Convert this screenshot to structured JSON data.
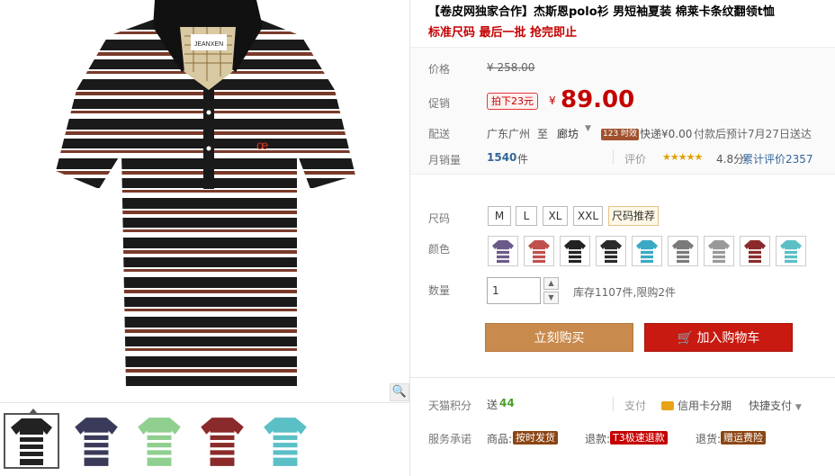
{
  "product": {
    "title": "【卷皮网独家合作】杰斯恩polo衫 男短袖夏装 棉莱卡条纹翻领t恤",
    "subtitle": "标准尺码 最后一批 抢完即止",
    "brand_label": "JEANXEN"
  },
  "price": {
    "label": "价格",
    "original": "¥ 258.00",
    "promo_label": "促销",
    "promo_badge": "拍下23元",
    "currency": "¥",
    "current": "89.00"
  },
  "delivery": {
    "label": "配送",
    "from": "广东广州",
    "to_word": "至",
    "to": "廊坊",
    "time_badge": "123 时效",
    "fee": "快递¥0.00",
    "eta": "付款后预计7月27日送达"
  },
  "sales": {
    "label": "月销量",
    "count": "1540",
    "unit": "件",
    "rating_label": "评价",
    "stars": "★★★★★",
    "score": "4.8分",
    "review_link": "累计评价2357"
  },
  "size": {
    "label": "尺码",
    "options": [
      "M",
      "L",
      "XL",
      "XXL"
    ],
    "tip": "尺码推荐"
  },
  "color": {
    "label": "颜色",
    "swatches": [
      "#6a5a8a",
      "#c0504d",
      "#222222",
      "#2a2a2a",
      "#3aa9c4",
      "#7a7a7a",
      "#999999",
      "#8b2a2a",
      "#5bbfc6"
    ]
  },
  "quantity": {
    "label": "数量",
    "value": "1",
    "stock": "库存1107件,限购2件"
  },
  "actions": {
    "buy_now": "立刻购买",
    "add_cart": "加入购物车"
  },
  "points": {
    "label": "天猫积分",
    "prefix": "送",
    "value": "44",
    "pay_label": "支付",
    "credit": "信用卡分期",
    "quick_pay": "快捷支付"
  },
  "service": {
    "label": "服务承诺",
    "goods_label": "商品:",
    "goods_tag": "按时发货",
    "refund_label": "退款:",
    "refund_tag": "T3极速退款",
    "return_label": "退货:",
    "return_tag": "赠运费险"
  },
  "colors": {
    "accent_red": "#c40000",
    "buy_button": "#c98a4d",
    "cart_button": "#c81a10"
  }
}
